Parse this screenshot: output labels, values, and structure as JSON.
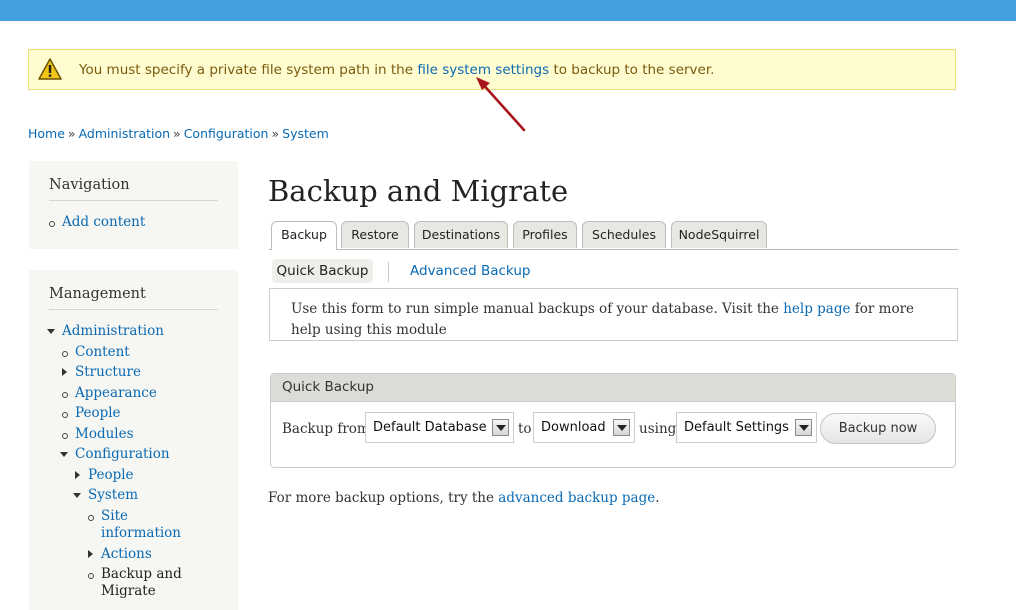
{
  "warning": {
    "text_before": "You must specify a private file system path in the",
    "link": "file system settings",
    "text_after": "to backup to the server."
  },
  "breadcrumb": [
    "Home",
    "Administration",
    "Configuration",
    "System"
  ],
  "breadcrumb_sep": "»",
  "sidebar": {
    "navigation": {
      "title": "Navigation",
      "items": [
        "Add content"
      ]
    },
    "management": {
      "title": "Management",
      "items": {
        "administration": "Administration",
        "content": "Content",
        "structure": "Structure",
        "appearance": "Appearance",
        "people": "People",
        "modules": "Modules",
        "configuration": "Configuration",
        "config_people": "People",
        "system": "System",
        "site_info_1": "Site",
        "site_info_2": "information",
        "actions": "Actions",
        "backup_1": "Backup and",
        "backup_2": "Migrate"
      }
    }
  },
  "page": {
    "title": "Backup and Migrate",
    "tabs": [
      "Backup",
      "Restore",
      "Destinations",
      "Profiles",
      "Schedules",
      "NodeSquirrel"
    ],
    "subtabs": {
      "active": "Quick Backup",
      "other": "Advanced Backup"
    },
    "intro": {
      "before": "Use this form to run simple manual backups of your database. Visit the",
      "link": "help page",
      "after": "for more help using this module"
    },
    "quick_backup": {
      "legend": "Quick Backup",
      "label_from": "Backup from",
      "source": "Default Database",
      "label_to": "to",
      "destination": "Download",
      "label_using": "using",
      "profile": "Default Settings",
      "button": "Backup now"
    },
    "more": {
      "before": "For more backup options, try the",
      "link": "advanced backup page",
      "after": "."
    }
  },
  "colors": {
    "topbar": "#42a0dc",
    "link": "#0a6ab3",
    "warning_bg": "#fffdcf",
    "arrow": "#a8141c"
  }
}
